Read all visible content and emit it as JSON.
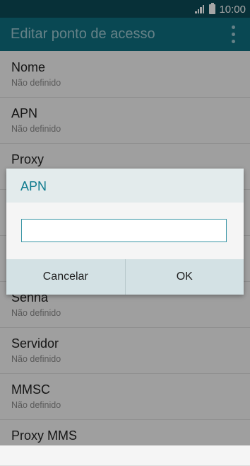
{
  "status_bar": {
    "time": "10:00",
    "icons": [
      "signal-icon",
      "battery-icon"
    ]
  },
  "app_bar": {
    "title": "Editar ponto de acesso",
    "menu_icon": "more-vert-icon"
  },
  "list": {
    "items": [
      {
        "title": "Nome",
        "subtitle": "Não definido"
      },
      {
        "title": "APN",
        "subtitle": "Não definido"
      },
      {
        "title": "Proxy",
        "subtitle": ""
      },
      {
        "title": "",
        "subtitle": ""
      },
      {
        "title": "",
        "subtitle": ""
      },
      {
        "title": "Senha",
        "subtitle": "Não definido"
      },
      {
        "title": "Servidor",
        "subtitle": "Não definido"
      },
      {
        "title": "MMSC",
        "subtitle": "Não definido"
      },
      {
        "title": "Proxy MMS",
        "subtitle": ""
      }
    ]
  },
  "dialog": {
    "title": "APN",
    "input_value": "",
    "cancel_label": "Cancelar",
    "ok_label": "OK"
  },
  "colors": {
    "status_bar": "#0c4a56",
    "app_bar": "#0f6f80",
    "accent": "#0f7b8e",
    "dialog_buttons": "#d3e1e4"
  }
}
